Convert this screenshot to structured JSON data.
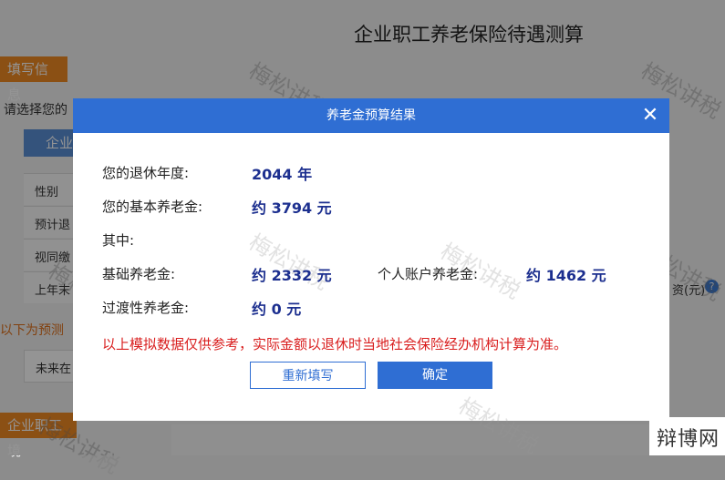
{
  "background": {
    "page_title": "企业职工养老保险待遇测算",
    "tag_fill_info": "填写信息",
    "prompt_text": "请选择您的",
    "type_button_label": "企业",
    "rows": [
      "性别",
      "预计退",
      "视同缴",
      "上年末"
    ],
    "projection_text": "以下为预测",
    "future_row": "未来在",
    "right_label": "资(元)",
    "section_tag": "企业职工境"
  },
  "dialog": {
    "title": "养老金预算结果",
    "close_symbol": "✕",
    "fields": {
      "retire_year_label": "您的退休年度:",
      "retire_year_value": "2044 年",
      "basic_pension_label": "您的基本养老金:",
      "basic_pension_value": "约 3794 元",
      "among_label": "其中:",
      "base_pension_label": "基础养老金:",
      "base_pension_value": "约 2332 元",
      "personal_account_label": "个人账户养老金:",
      "personal_account_value": "约 1462 元",
      "transitional_label": "过渡性养老金:",
      "transitional_value": "约 0 元"
    },
    "notice": "以上模拟数据仅供参考，实际金额以退休时当地社会保险经办机构计算为准。",
    "buttons": {
      "refill": "重新填写",
      "confirm": "确定"
    }
  },
  "watermark_text": "梅松讲税",
  "logo_text": "辩博网",
  "colors": {
    "primary_blue": "#2f6ed3",
    "value_navy": "#1c2f8f",
    "notice_red": "#d91e1e",
    "tag_orange": "#f08a24"
  }
}
